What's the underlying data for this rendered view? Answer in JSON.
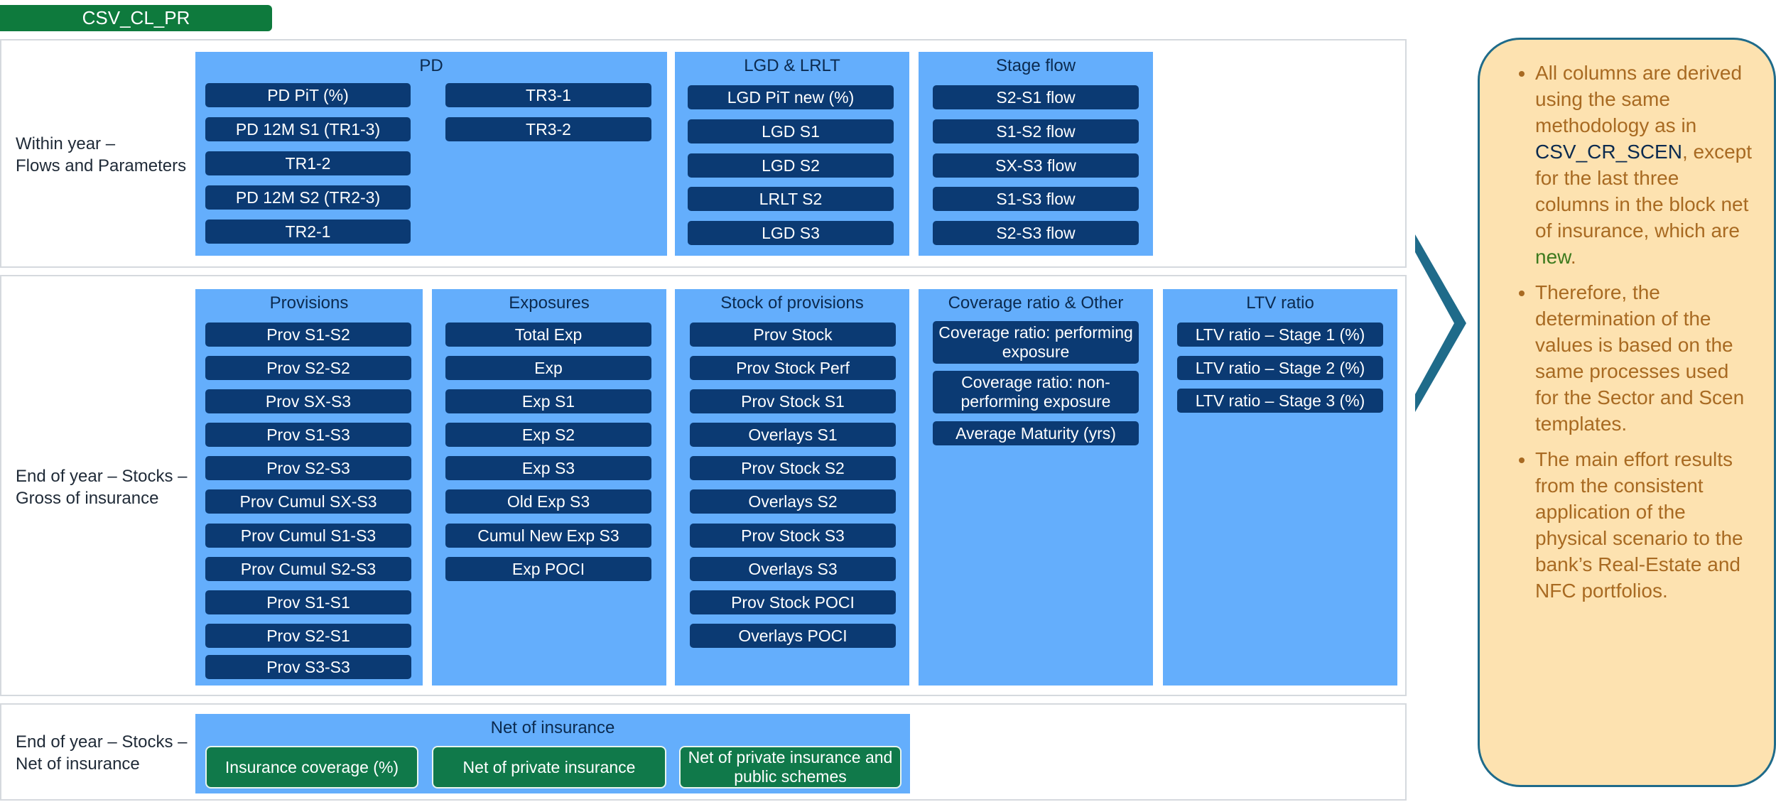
{
  "header": {
    "title": "CSV_CL_PR"
  },
  "rows": {
    "within_year": {
      "label_line1": "Within year –",
      "label_line2": "Flows and Parameters"
    },
    "gross": {
      "label_line1": "End of year – Stocks –",
      "label_line2": "Gross of insurance"
    },
    "net": {
      "label_line1": "End of year – Stocks –",
      "label_line2": "Net of insurance"
    }
  },
  "pd": {
    "title": "PD",
    "left": [
      "PD PiT (%)",
      "PD 12M S1 (TR1-3)",
      "TR1-2",
      "PD 12M S2 (TR2-3)",
      "TR2-1"
    ],
    "right": [
      "TR3-1",
      "TR3-2"
    ]
  },
  "lgd": {
    "title": "LGD & LRLT",
    "items": [
      "LGD PiT new (%)",
      "LGD S1",
      "LGD S2",
      "LRLT S2",
      "LGD S3"
    ]
  },
  "stage_flow": {
    "title": "Stage flow",
    "items": [
      "S2-S1 flow",
      "S1-S2 flow",
      "SX-S3 flow",
      "S1-S3 flow",
      "S2-S3 flow"
    ]
  },
  "provisions": {
    "title": "Provisions",
    "items": [
      "Prov S1-S2",
      "Prov S2-S2",
      "Prov SX-S3",
      "Prov S1-S3",
      "Prov S2-S3",
      "Prov Cumul SX-S3",
      "Prov Cumul S1-S3",
      "Prov Cumul S2-S3",
      "Prov S1-S1",
      "Prov S2-S1",
      "Prov S3-S3"
    ]
  },
  "exposures": {
    "title": "Exposures",
    "items": [
      "Total Exp",
      "Exp",
      "Exp S1",
      "Exp S2",
      "Exp S3",
      "Old Exp S3",
      "Cumul New Exp S3",
      "Exp POCI"
    ]
  },
  "stock_provisions": {
    "title": "Stock of provisions",
    "items": [
      "Prov Stock",
      "Prov Stock Perf",
      "Prov Stock S1",
      "Overlays S1",
      "Prov Stock S2",
      "Overlays S2",
      "Prov Stock S3",
      "Overlays S3",
      "Prov Stock POCI",
      "Overlays POCI"
    ]
  },
  "coverage": {
    "title": "Coverage ratio & Other",
    "items": [
      "Coverage ratio: performing exposure",
      "Coverage ratio: non-performing exposure",
      "Average Maturity (yrs)"
    ]
  },
  "ltv": {
    "title": "LTV ratio",
    "items": [
      "LTV ratio – Stage 1 (%)",
      "LTV ratio – Stage 2 (%)",
      "LTV ratio – Stage 3 (%)"
    ]
  },
  "net_insurance": {
    "title": "Net of insurance",
    "items": [
      "Insurance coverage (%)",
      "Net of private insurance",
      "Net of private insurance and public schemes"
    ]
  },
  "note": {
    "b1_a": "All columns are derived using the same methodology as in ",
    "b1_hl": "CSV_CR_SCEN",
    "b1_b": ", except for the last three columns in the block net of insurance, which are ",
    "b1_new": "new",
    "b1_c": ".",
    "b2": "Therefore, the determination of the values is based on the same processes used for the Sector and Scen templates.",
    "b3": "The main effort results from the consistent application of the physical scenario to the bank’s Real-Estate and NFC portfolios."
  },
  "colors": {
    "panel": "#64aefc",
    "pill": "#0b3a73",
    "green": "#10794a",
    "note_bg": "#fde2b0",
    "note_border": "#1f6b8a",
    "arrow": "#1f6b8a"
  }
}
